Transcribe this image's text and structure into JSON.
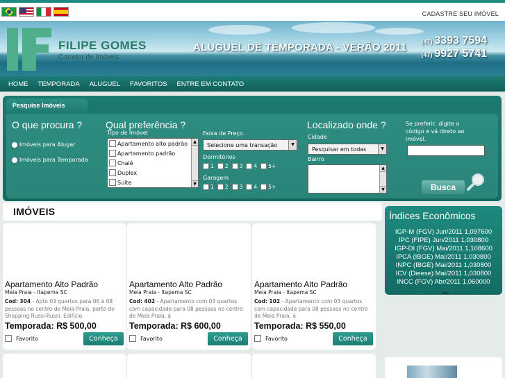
{
  "topbar": {
    "flags": [
      "Português",
      "English",
      "Italiano",
      "Español"
    ],
    "register_link": "CADASTRE SEU IMÓVEL"
  },
  "banner": {
    "brand_name": "FILIPE GOMES",
    "brand_subtitle": "Corretor de Imóveis",
    "headline": "ALUGUEL DE TEMPORADA - VERÃO 2011",
    "phone1_ddd": "(47)",
    "phone1_number": "3393 7594",
    "phone2_ddd": "(47)",
    "phone2_number": "9927 5741"
  },
  "nav": {
    "items": [
      "HOME",
      "TEMPORADA",
      "ALUGUEL",
      "FAVORITOS",
      "ENTRE EM CONTATO"
    ]
  },
  "search": {
    "tab_label": "Pesquise Imóveis",
    "o_que_heading": "O que procura ?",
    "radio_alugar": "Imóveis para Alugar",
    "radio_temporada": "Imóveis para Temporada",
    "pref_heading": "Qual preferência ?",
    "tipo_label": "Tipo de Imóvel",
    "tipo_options": [
      "Apartamento alto padrão",
      "Apartamento padrão",
      "Chalé",
      "Duplex",
      "Suíte"
    ],
    "faixa_label": "Faixa de Preço",
    "faixa_value": "Selecione uma transação",
    "dormitorios_label": "Dormitórios",
    "garagem_label": "Garagem",
    "count_options": [
      "1",
      "2",
      "3",
      "4",
      "5+"
    ],
    "local_heading": "Localizado onde ?",
    "cidade_label": "Cidade",
    "cidade_value": "Pesquisar em todas",
    "bairro_label": "Bairro",
    "codigo_text": "Se preferir, digite o código e vá direto ao imóvel.",
    "busca_label": "Busca"
  },
  "main": {
    "section_title": "IMÓVEIS",
    "cards": [
      {
        "title": "Apartamento Alto Padrão",
        "location": "Meia Praia - Itapema SC",
        "code_label": "Cod:",
        "code": "304",
        "description": "- Apto 03 quartos para 06 à 08 pessoas no centro de Meia Praia, perto do Shopping Russi-Russi. Edifício",
        "price": "Temporada: R$ 500,00",
        "fav_label": "Favorito",
        "button": "Conheça"
      },
      {
        "title": "Apartamento Alto Padrão",
        "location": "Meia Praia - Itapema SC",
        "code_label": "Cod:",
        "code": "402",
        "description": "- Apartamento com 03 quartos com capacidade para 08 pessoas no centro de Meia Praia, á",
        "price": "Temporada: R$ 600,00",
        "fav_label": "Favorito",
        "button": "Conheça"
      },
      {
        "title": "Apartamento Alto Padrão",
        "location": "Meia Praia - Itapema SC",
        "code_label": "Cod:",
        "code": "102",
        "description": "- Apartamento com 03 quartos com capacidade para 08 pessoas no centro de Meia Praia, á",
        "price": "Temporada: R$ 550,00",
        "fav_label": "Favorito",
        "button": "Conheça"
      }
    ]
  },
  "sidebar": {
    "indices_title": "Índices Econômicos",
    "indices": [
      "IGP-M (FGV) Jun/2011 1,097600",
      "IPC (FIPE) Jun/2011 1,030800",
      "IGP-DI (FGV) Mai/2011 1,108600",
      "IPCA (IBGE) Mai/2011 1,030800",
      "INPC (IBGE) Mai/2011 1,030800",
      "ICV (Dieese) Mai/2011 1,030800",
      "INCC (FGV) Abr/2011 1,060000"
    ]
  },
  "colors": {
    "accent": "#1d7e73",
    "nav_bg": "#15706a",
    "brand_green": "#4fae8c"
  }
}
